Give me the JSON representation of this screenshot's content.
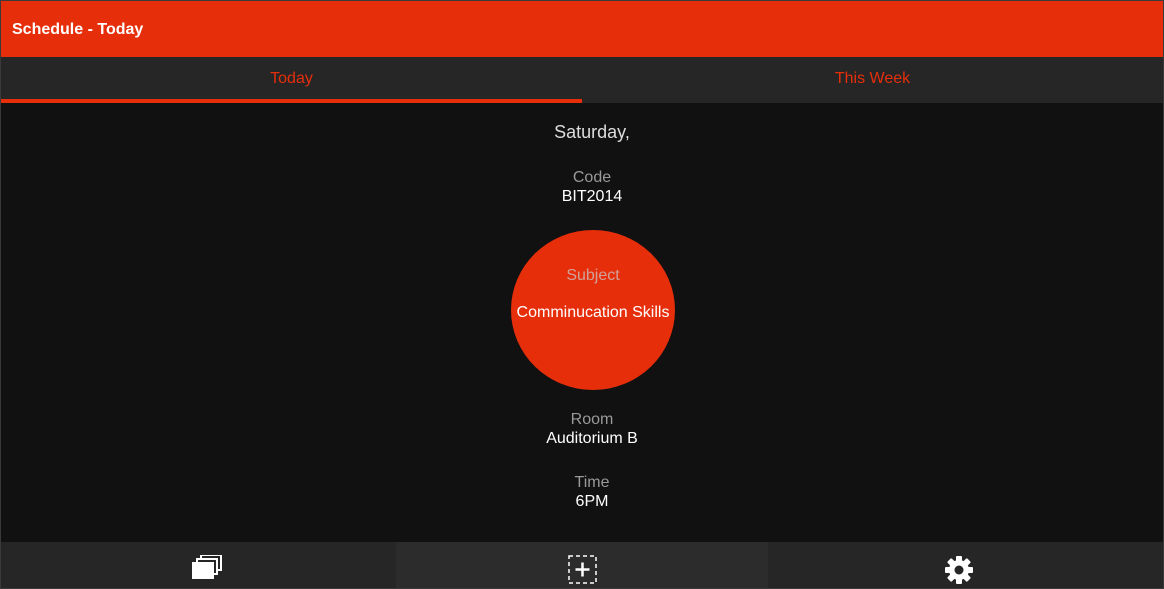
{
  "window": {
    "title": "Schedule - Today"
  },
  "tabs": [
    {
      "label": "Today",
      "active": true
    },
    {
      "label": "This Week",
      "active": false
    }
  ],
  "schedule": {
    "day": "Saturday,",
    "code": {
      "label": "Code",
      "value": "BIT2014"
    },
    "subject": {
      "label": "Subject",
      "value": "Comminucation Skills"
    },
    "room": {
      "label": "Room",
      "value": "Auditorium B"
    },
    "time": {
      "label": "Time",
      "value": "6PM"
    }
  },
  "bottom_bar": {
    "buttons": [
      {
        "icon": "stacked-cards-icon"
      },
      {
        "icon": "add-box-icon"
      },
      {
        "icon": "gear-icon"
      }
    ]
  },
  "colors": {
    "accent": "#e62e0b",
    "background": "#111111",
    "bar": "#262626"
  }
}
